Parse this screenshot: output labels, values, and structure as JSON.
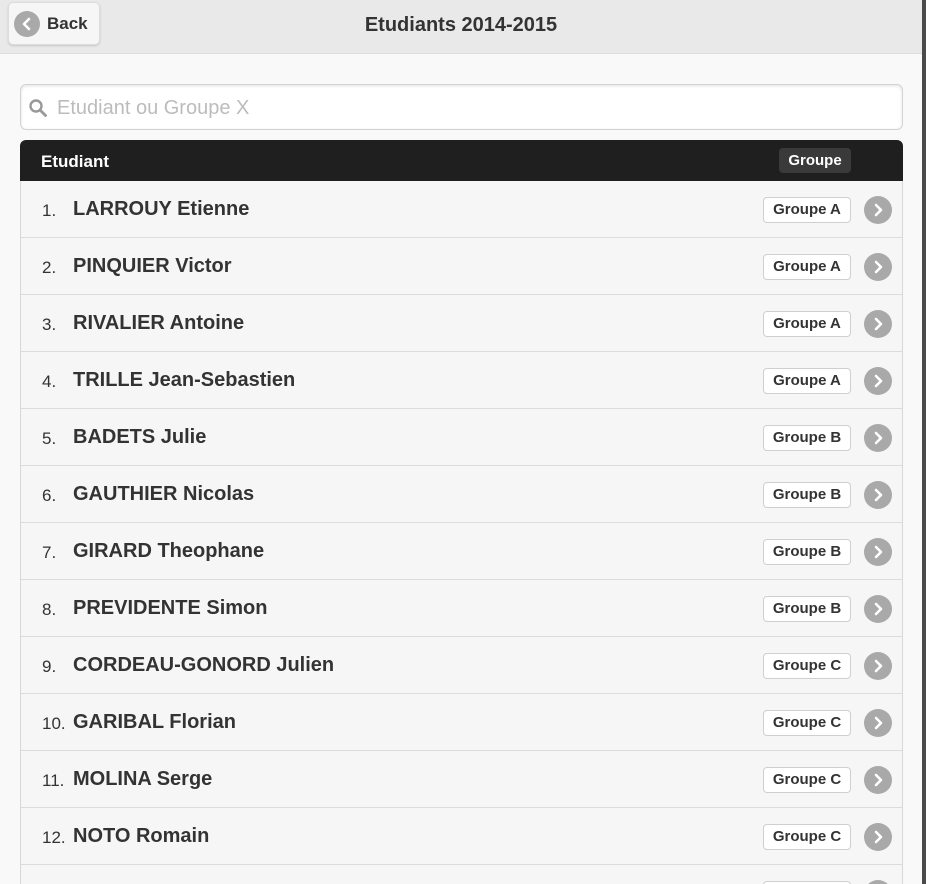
{
  "header": {
    "back_label": "Back",
    "title": "Etudiants 2014-2015"
  },
  "search": {
    "placeholder": "Etudiant ou Groupe X",
    "value": ""
  },
  "list_header": {
    "student_col": "Etudiant",
    "group_col": "Groupe"
  },
  "students": [
    {
      "num": "1.",
      "name": "LARROUY Etienne",
      "group": "Groupe A"
    },
    {
      "num": "2.",
      "name": "PINQUIER Victor",
      "group": "Groupe A"
    },
    {
      "num": "3.",
      "name": "RIVALIER Antoine",
      "group": "Groupe A"
    },
    {
      "num": "4.",
      "name": "TRILLE Jean-Sebastien",
      "group": "Groupe A"
    },
    {
      "num": "5.",
      "name": "BADETS Julie",
      "group": "Groupe B"
    },
    {
      "num": "6.",
      "name": "GAUTHIER Nicolas",
      "group": "Groupe B"
    },
    {
      "num": "7.",
      "name": "GIRARD Theophane",
      "group": "Groupe B"
    },
    {
      "num": "8.",
      "name": "PREVIDENTE Simon",
      "group": "Groupe B"
    },
    {
      "num": "9.",
      "name": "CORDEAU-GONORD Julien",
      "group": "Groupe C"
    },
    {
      "num": "10.",
      "name": "GARIBAL Florian",
      "group": "Groupe C"
    },
    {
      "num": "11.",
      "name": "MOLINA Serge",
      "group": "Groupe C"
    },
    {
      "num": "12.",
      "name": "NOTO Romain",
      "group": "Groupe C"
    }
  ],
  "icons": {
    "back": "chevron-left-icon",
    "search": "search-icon",
    "row": "chevron-right-icon"
  }
}
